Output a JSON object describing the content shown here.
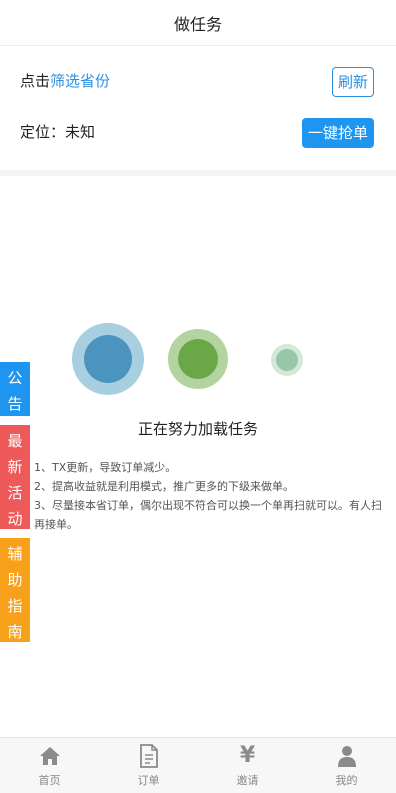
{
  "header": {
    "title": "做任务"
  },
  "filter": {
    "prefix": "点击",
    "link": "筛选省份",
    "refresh_label": "刷新",
    "location_label": "定位：",
    "location_value": "未知",
    "grab_label": "一键抢单"
  },
  "loading": {
    "text": "正在努力加载任务"
  },
  "tips": [
    "1、TX更新，导致订单减少。",
    "2、提高收益就是利用模式，推广更多的下级来做单。",
    "3、尽量接本省订单，偶尔出现不符合可以换一个单再扫就可以。有人扫再接单。"
  ],
  "side_tabs": {
    "notice": [
      "公",
      "告"
    ],
    "activity": [
      "最",
      "新",
      "活",
      "动"
    ],
    "guide": [
      "辅",
      "助",
      "指",
      "南"
    ]
  },
  "bottom_nav": [
    {
      "label": "首页",
      "icon": "home-icon"
    },
    {
      "label": "订单",
      "icon": "document-icon"
    },
    {
      "label": "邀请",
      "icon": "yen-icon"
    },
    {
      "label": "我的",
      "icon": "user-icon"
    }
  ],
  "colors": {
    "accent_blue": "#1e96f0",
    "link_blue": "#2b8fe0",
    "activity_red": "#ee5a5a",
    "guide_orange": "#f7a11a"
  }
}
